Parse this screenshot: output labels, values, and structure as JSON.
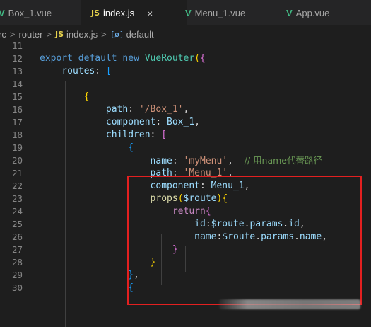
{
  "tabs": [
    {
      "label": "Box_1.vue",
      "icon": "vue-icon"
    },
    {
      "label": "index.js",
      "icon": "js-icon",
      "active": true
    },
    {
      "label": "Menu_1.vue",
      "icon": "vue-icon"
    },
    {
      "label": "App.vue",
      "icon": "vue-icon"
    }
  ],
  "tab_icons": {
    "vue": "V",
    "js": "JS",
    "close": "×"
  },
  "breadcrumb": {
    "items": [
      "rc",
      "router",
      "index.js",
      "default"
    ],
    "separator": ">",
    "js_badge": "JS",
    "symbol_badge": "[ø]"
  },
  "editor": {
    "lines": [
      {
        "n": "11",
        "tokens": []
      },
      {
        "n": "12",
        "tokens": [
          [
            "kw",
            "export "
          ],
          [
            "kw",
            "default "
          ],
          [
            "kw",
            "new "
          ],
          [
            "cls",
            "VueRouter"
          ],
          [
            "br1",
            "("
          ],
          [
            "br2",
            "{"
          ]
        ]
      },
      {
        "n": "13",
        "tokens": [
          [
            "pl",
            "    "
          ],
          [
            "prop",
            "routes"
          ],
          [
            "pl",
            ": "
          ],
          [
            "br3",
            "["
          ]
        ]
      },
      {
        "n": "14",
        "tokens": []
      },
      {
        "n": "15",
        "tokens": [
          [
            "pl",
            "        "
          ],
          [
            "br1",
            "{"
          ]
        ]
      },
      {
        "n": "16",
        "tokens": [
          [
            "pl",
            "            "
          ],
          [
            "prop",
            "path"
          ],
          [
            "pl",
            ": "
          ],
          [
            "str",
            "'/Box_1'"
          ],
          [
            "pl",
            ","
          ]
        ]
      },
      {
        "n": "17",
        "tokens": [
          [
            "pl",
            "            "
          ],
          [
            "prop",
            "component"
          ],
          [
            "pl",
            ": "
          ],
          [
            "prop",
            "Box_1"
          ],
          [
            "pl",
            ","
          ]
        ]
      },
      {
        "n": "18",
        "tokens": [
          [
            "pl",
            "            "
          ],
          [
            "prop",
            "children"
          ],
          [
            "pl",
            ": "
          ],
          [
            "br2",
            "["
          ]
        ]
      },
      {
        "n": "19",
        "tokens": [
          [
            "pl",
            "                "
          ],
          [
            "br3",
            "{"
          ]
        ]
      },
      {
        "n": "20",
        "tokens": [
          [
            "pl",
            "                    "
          ],
          [
            "prop",
            "name"
          ],
          [
            "pl",
            ": "
          ],
          [
            "str",
            "'myMenu'"
          ],
          [
            "pl",
            ",  "
          ],
          [
            "cmt",
            "// 用name代替路径"
          ]
        ]
      },
      {
        "n": "21",
        "tokens": [
          [
            "pl",
            "                    "
          ],
          [
            "prop",
            "path"
          ],
          [
            "pl",
            ": "
          ],
          [
            "str",
            "'Menu_1'"
          ],
          [
            "pl",
            ","
          ]
        ]
      },
      {
        "n": "22",
        "tokens": [
          [
            "pl",
            "                    "
          ],
          [
            "prop",
            "component"
          ],
          [
            "pl",
            ": "
          ],
          [
            "prop",
            "Menu_1"
          ],
          [
            "pl",
            ","
          ]
        ]
      },
      {
        "n": "23",
        "tokens": [
          [
            "pl",
            "                    "
          ],
          [
            "fn",
            "props"
          ],
          [
            "br1",
            "("
          ],
          [
            "prop",
            "$route"
          ],
          [
            "br1",
            ")"
          ],
          [
            "br1",
            "{"
          ]
        ]
      },
      {
        "n": "24",
        "tokens": [
          [
            "pl",
            "                        "
          ],
          [
            "kw2",
            "return"
          ],
          [
            "br2",
            "{"
          ]
        ]
      },
      {
        "n": "25",
        "tokens": [
          [
            "pl",
            "                            "
          ],
          [
            "prop",
            "id"
          ],
          [
            "pl",
            ":"
          ],
          [
            "prop",
            "$route"
          ],
          [
            "pl",
            "."
          ],
          [
            "prop",
            "params"
          ],
          [
            "pl",
            "."
          ],
          [
            "prop",
            "id"
          ],
          [
            "pl",
            ","
          ]
        ]
      },
      {
        "n": "26",
        "tokens": [
          [
            "pl",
            "                            "
          ],
          [
            "prop",
            "name"
          ],
          [
            "pl",
            ":"
          ],
          [
            "prop",
            "$route"
          ],
          [
            "pl",
            "."
          ],
          [
            "prop",
            "params"
          ],
          [
            "pl",
            "."
          ],
          [
            "prop",
            "name"
          ],
          [
            "pl",
            ","
          ]
        ]
      },
      {
        "n": "27",
        "tokens": [
          [
            "pl",
            "                        "
          ],
          [
            "br2",
            "}"
          ]
        ]
      },
      {
        "n": "28",
        "tokens": [
          [
            "pl",
            "                    "
          ],
          [
            "br1",
            "}"
          ]
        ]
      },
      {
        "n": "29",
        "tokens": [
          [
            "pl",
            "                "
          ],
          [
            "br3",
            "}"
          ],
          [
            "pl",
            ","
          ]
        ]
      },
      {
        "n": "30",
        "tokens": [
          [
            "pl",
            "                "
          ],
          [
            "br3",
            "{"
          ]
        ]
      }
    ]
  },
  "colors": {
    "highlight_box": "#e32020",
    "background": "#1e1e1e"
  }
}
